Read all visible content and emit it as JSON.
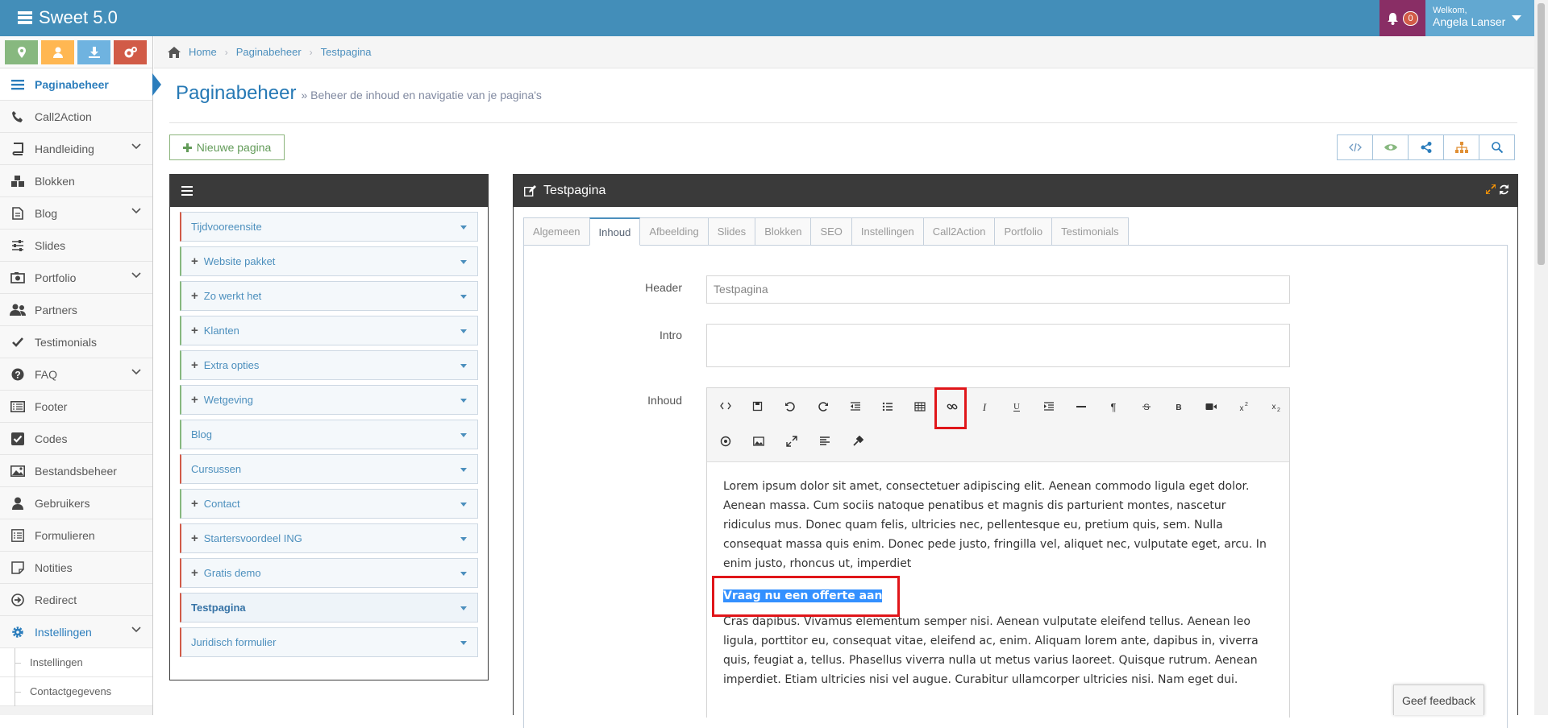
{
  "app": {
    "title": "Sweet 5.0"
  },
  "header": {
    "notifications_count": "0",
    "welcome": "Welkom,",
    "user_name": "Angela Lanser"
  },
  "sidebar": {
    "shortcuts": [
      {
        "icon": "map-marker-icon",
        "color": "#87b87f"
      },
      {
        "icon": "user-icon",
        "color": "#ffb752"
      },
      {
        "icon": "download-icon",
        "color": "#6fb3e0"
      },
      {
        "icon": "cogs-icon",
        "color": "#d15b47"
      }
    ],
    "items": [
      {
        "label": "Paginabeheer",
        "icon": "bars-icon",
        "active": true
      },
      {
        "label": "Call2Action",
        "icon": "phone-icon"
      },
      {
        "label": "Handleiding",
        "icon": "book-icon",
        "chevron": true
      },
      {
        "label": "Blokken",
        "icon": "cubes-icon"
      },
      {
        "label": "Blog",
        "icon": "file-icon",
        "chevron": true
      },
      {
        "label": "Slides",
        "icon": "sliders-icon"
      },
      {
        "label": "Portfolio",
        "icon": "camera-icon",
        "chevron": true
      },
      {
        "label": "Partners",
        "icon": "users-icon"
      },
      {
        "label": "Testimonials",
        "icon": "check-icon"
      },
      {
        "label": "FAQ",
        "icon": "question-icon",
        "chevron": true
      },
      {
        "label": "Footer",
        "icon": "list-alt-icon"
      },
      {
        "label": "Codes",
        "icon": "check-square-icon"
      },
      {
        "label": "Bestandsbeheer",
        "icon": "picture-icon"
      },
      {
        "label": "Gebruikers",
        "icon": "user-icon"
      },
      {
        "label": "Formulieren",
        "icon": "list-icon"
      },
      {
        "label": "Notities",
        "icon": "note-icon"
      },
      {
        "label": "Redirect",
        "icon": "arrow-circle-icon"
      },
      {
        "label": "Instellingen",
        "icon": "cog-icon",
        "chevron": true,
        "open": true
      }
    ],
    "subitems": [
      {
        "label": "Instellingen"
      },
      {
        "label": "Contactgegevens"
      }
    ]
  },
  "breadcrumb": {
    "items": [
      "Home",
      "Paginabeheer",
      "Testpagina"
    ]
  },
  "page": {
    "title": "Paginabeheer",
    "subtitle": "» Beheer de inhoud en navigatie van je pagina's"
  },
  "toolbar": {
    "new_page_label": "Nieuwe pagina"
  },
  "tree": {
    "items": [
      {
        "label": "Tijdvooreensite",
        "plus": false,
        "color": "red"
      },
      {
        "label": "Website pakket",
        "plus": true,
        "color": "green"
      },
      {
        "label": "Zo werkt het",
        "plus": true,
        "color": "green"
      },
      {
        "label": "Klanten",
        "plus": true,
        "color": "green"
      },
      {
        "label": "Extra opties",
        "plus": true,
        "color": "green"
      },
      {
        "label": "Wetgeving",
        "plus": true,
        "color": "green"
      },
      {
        "label": "Blog",
        "plus": false,
        "color": "green"
      },
      {
        "label": "Cursussen",
        "plus": false,
        "color": "red"
      },
      {
        "label": "Contact",
        "plus": true,
        "color": "green"
      },
      {
        "label": "Startersvoordeel ING",
        "plus": true,
        "color": "red"
      },
      {
        "label": "Gratis demo",
        "plus": true,
        "color": "red"
      },
      {
        "label": "Testpagina",
        "plus": false,
        "color": "red",
        "active": true
      },
      {
        "label": "Juridisch formulier",
        "plus": false,
        "color": "red"
      }
    ]
  },
  "editor_panel": {
    "title": "Testpagina",
    "tabs": [
      "Algemeen",
      "Inhoud",
      "Afbeelding",
      "Slides",
      "Blokken",
      "SEO",
      "Instellingen",
      "Call2Action",
      "Portfolio",
      "Testimonials"
    ],
    "active_tab": "Inhoud",
    "fields": {
      "header_label": "Header",
      "header_value": "Testpagina",
      "intro_label": "Intro",
      "intro_value": "",
      "content_label": "Inhoud"
    },
    "toolbar_row1": [
      "code-icon",
      "save-icon",
      "undo-icon",
      "redo-icon",
      "outdent-icon",
      "unordered-list-icon",
      "table-icon",
      "link-icon",
      "italic-icon",
      "underline-icon",
      "indent-icon",
      "horizontal-rule-icon",
      "paragraph-icon",
      "strikethrough-icon",
      "bold-icon",
      "video-icon",
      "superscript-icon",
      "subscript-icon"
    ],
    "toolbar_row2": [
      "info-circle-icon",
      "image-icon",
      "fullscreen-icon",
      "align-icon",
      "clear-format-icon"
    ],
    "toolbar_highlight": "link-icon",
    "content": {
      "p1": "Lorem ipsum dolor sit amet, consectetuer adipiscing elit. Aenean commodo ligula eget dolor. Aenean massa. Cum sociis natoque penatibus et magnis dis parturient montes, nascetur ridiculus mus. Donec quam felis, ultricies nec, pellentesque eu, pretium quis, sem. Nulla consequat massa quis enim. Donec pede justo, fringilla vel, aliquet nec, vulputate eget, arcu. In enim justo, rhoncus ut, imperdiet",
      "selected": "Vraag nu een offerte aan",
      "p2": "Cras dapibus. Vivamus elementum semper nisi. Aenean vulputate eleifend tellus. Aenean leo ligula, porttitor eu, consequat vitae, eleifend ac, enim. Aliquam lorem ante, dapibus in, viverra quis, feugiat a, tellus. Phasellus viverra nulla ut metus varius laoreet. Quisque rutrum. Aenean imperdiet. Etiam ultricies nisi vel augue. Curabitur ullamcorper ultricies nisi. Nam eget dui."
    }
  },
  "feedback": {
    "label": "Geef feedback"
  },
  "colors": {
    "topbar": "#438eb9",
    "accent": "#2b7dbc",
    "highlight": "#e0161a",
    "selection": "#3390ff"
  }
}
